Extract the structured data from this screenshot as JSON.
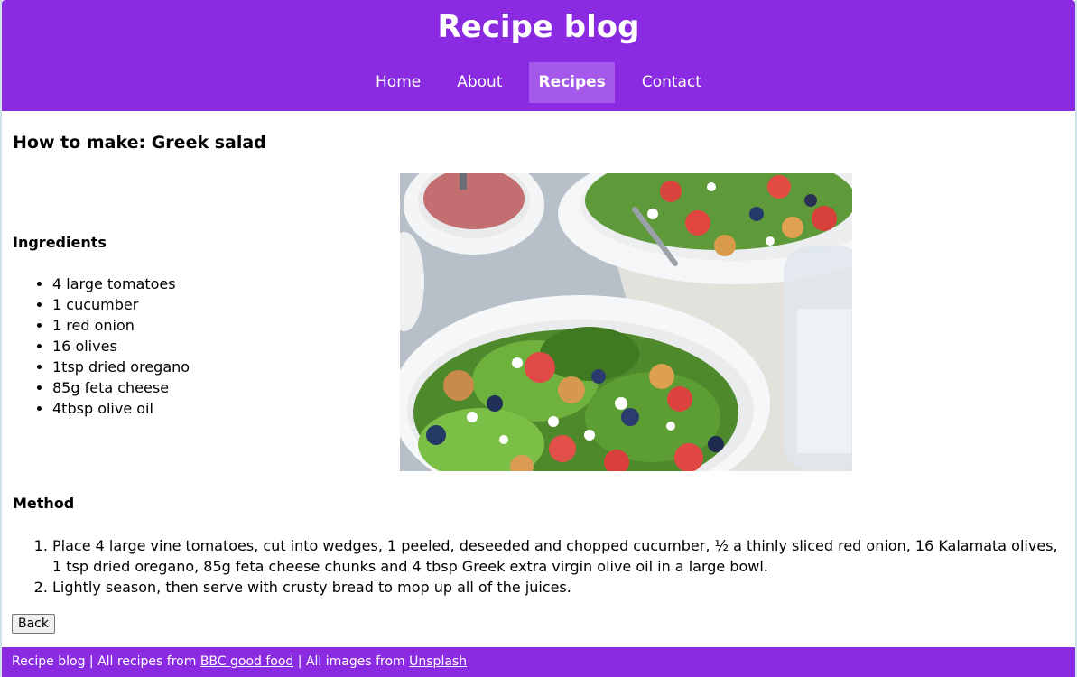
{
  "header": {
    "title": "Recipe blog",
    "nav": [
      {
        "label": "Home",
        "active": false
      },
      {
        "label": "About",
        "active": false
      },
      {
        "label": "Recipes",
        "active": true
      },
      {
        "label": "Contact",
        "active": false
      }
    ]
  },
  "recipe": {
    "title": "How to make: Greek salad",
    "ingredients_heading": "Ingredients",
    "ingredients": [
      "4 large tomatoes",
      "1 cucumber",
      "1 red onion",
      "16 olives",
      "1tsp dried oregano",
      "85g feta cheese",
      "4tbsp olive oil"
    ],
    "method_heading": "Method",
    "method": [
      "Place 4 large vine tomatoes, cut into wedges, 1 peeled, deseeded and chopped cucumber, ½ a thinly sliced red onion, 16 Kalamata olives, 1 tsp dried oregano, 85g feta cheese chunks and 4 tbsp Greek extra virgin olive oil in a large bowl.",
      "Lightly season, then serve with crusty bread to mop up all of the juices."
    ],
    "back_label": "Back"
  },
  "footer": {
    "prefix": "Recipe blog | All recipes from ",
    "recipes_link": "BBC good food",
    "middle": " | All images from ",
    "images_link": "Unsplash"
  },
  "colors": {
    "brand": "#8a2be2",
    "nav_active": "#a559ea"
  }
}
